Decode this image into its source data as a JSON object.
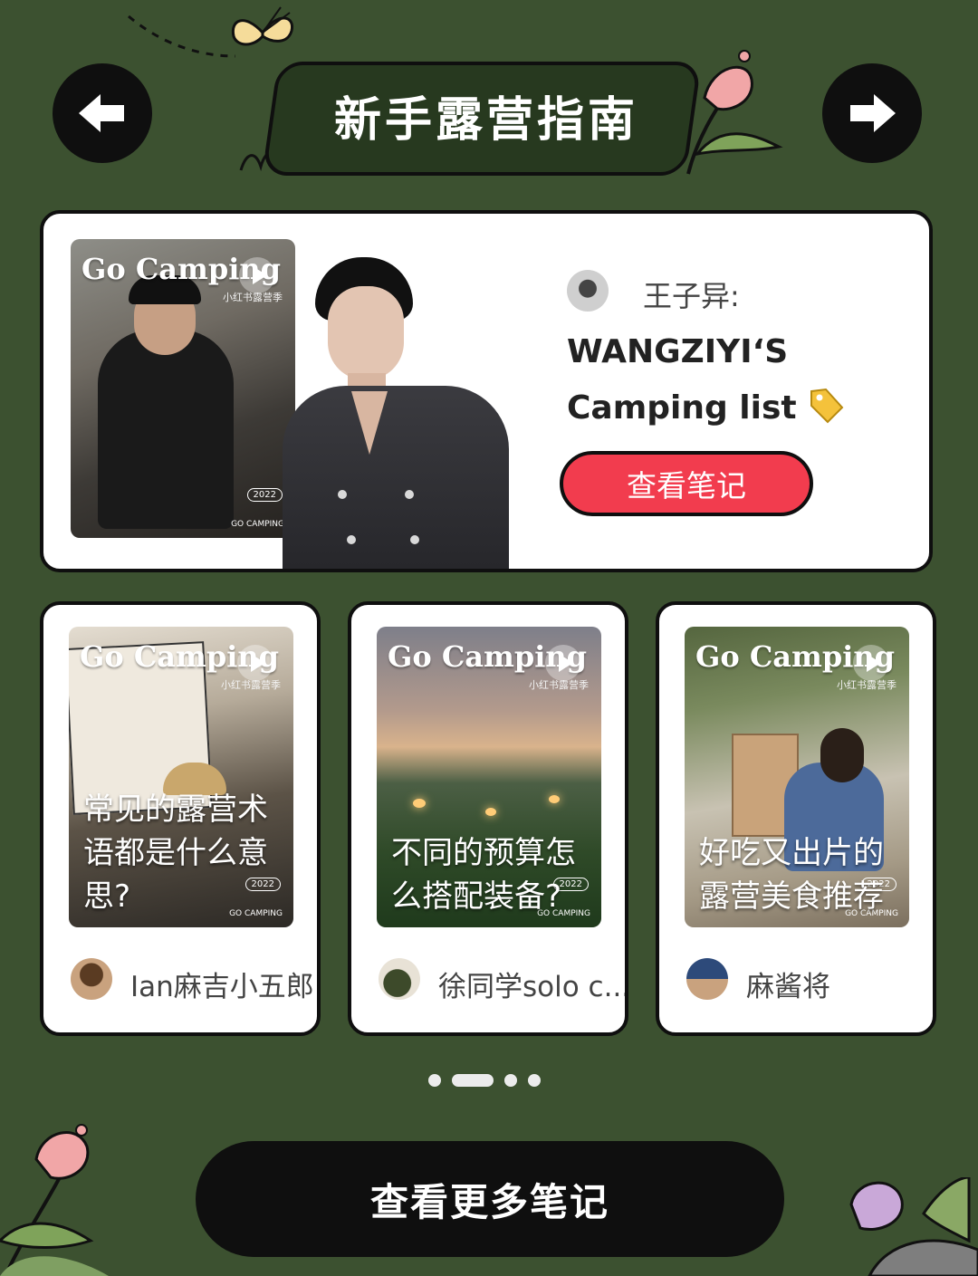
{
  "header": {
    "title": "新手露营指南",
    "back_icon": "arrow-left-icon",
    "forward_icon": "arrow-right-icon"
  },
  "featured": {
    "thumb_brand": "Go Camping",
    "thumb_sub": "小红书露营季",
    "thumb_year": "2022",
    "thumb_logo": "GO CAMPING",
    "author": "王子异:",
    "title_line1": "WANGZIYI‘S",
    "title_line2": "Camping list",
    "tag_icon": "price-tag-emoji",
    "button": "查看笔记"
  },
  "notes": [
    {
      "brand": "Go Camping",
      "sub": "小红书露营季",
      "year": "2022",
      "logo": "GO CAMPING",
      "title": "常见的露营术语都是什么意思?",
      "author": "Ian麻吉小五郎"
    },
    {
      "brand": "Go Camping",
      "sub": "小红书露营季",
      "year": "2022",
      "logo": "GO CAMPING",
      "title": "不同的预算怎么搭配装备?",
      "author": "徐同学solo c..."
    },
    {
      "brand": "Go Camping",
      "sub": "小红书露营季",
      "year": "2022",
      "logo": "GO CAMPING",
      "title": "好吃又出片的露营美食推荐",
      "author": "麻酱将"
    }
  ],
  "pagination": {
    "total": 4,
    "active": 1
  },
  "more_button": "查看更多笔记",
  "colors": {
    "background": "#3c5130",
    "banner": "#27391f",
    "accent_red": "#f23c4e",
    "black": "#0f0f0f",
    "white": "#ffffff"
  }
}
